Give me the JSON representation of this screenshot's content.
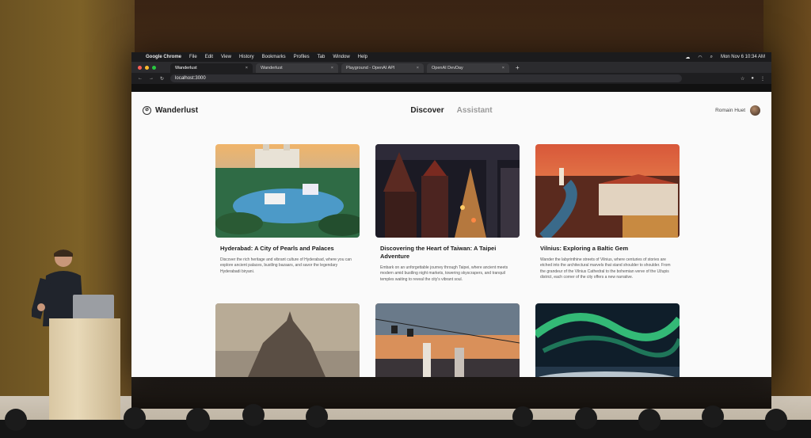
{
  "browser": {
    "app_name": "Google Chrome",
    "menus": [
      "File",
      "Edit",
      "View",
      "History",
      "Bookmarks",
      "Profiles",
      "Tab",
      "Window",
      "Help"
    ],
    "clock": "Mon Nov 6  10:34 AM",
    "tabs": [
      {
        "label": "Wanderlust",
        "active": true
      },
      {
        "label": "Wanderlust",
        "active": false
      },
      {
        "label": "Playground - OpenAI API",
        "active": false
      },
      {
        "label": "OpenAI DevDay",
        "active": false
      }
    ],
    "url": "localhost:3000"
  },
  "app": {
    "brand": "Wanderlust",
    "nav": {
      "discover": "Discover",
      "assistant": "Assistant"
    },
    "user_name": "Romain Huet"
  },
  "cards": [
    {
      "title": "Hyderabad: A City of Pearls and Palaces",
      "description": "Discover the rich heritage and vibrant culture of Hyderabad, where you can explore ancient palaces, bustling bazaars, and savor the legendary Hyderabadi biryani.",
      "image": "hyderabad-palace-lake"
    },
    {
      "title": "Discovering the Heart of Taiwan: A Taipei Adventure",
      "description": "Embark on an unforgettable journey through Taipei, where ancient meets modern amid bustling night markets, towering skyscrapers, and tranquil temples waiting to reveal the city's vibrant soul.",
      "image": "taipei-night-temple"
    },
    {
      "title": "Vilnius: Exploring a Baltic Gem",
      "description": "Wander the labyrinthine streets of Vilnius, where centuries of stories are etched into the architectural marvels that stand shoulder to shoulder. From the grandeur of the Vilnius Cathedral to the bohemian verve of the Užupis district, each corner of the city offers a new narrative.",
      "image": "vilnius-sunset-river"
    },
    {
      "title": "",
      "description": "",
      "image": "mont-saint-michel"
    },
    {
      "title": "",
      "description": "",
      "image": "cable-car-city"
    },
    {
      "title": "",
      "description": "",
      "image": "aurora-night"
    }
  ],
  "colors": {
    "page_bg": "#fafafa",
    "chrome_dark": "#1e1e20",
    "text": "#1c1c1c"
  }
}
